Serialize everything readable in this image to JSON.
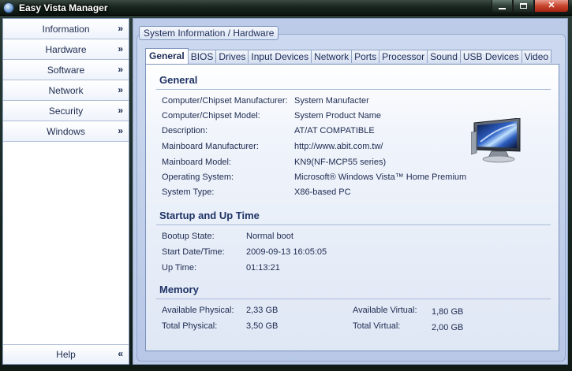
{
  "window": {
    "title": "Easy Vista Manager"
  },
  "sidebar": {
    "items": [
      {
        "label": "Information"
      },
      {
        "label": "Hardware"
      },
      {
        "label": "Software"
      },
      {
        "label": "Network"
      },
      {
        "label": "Security"
      },
      {
        "label": "Windows"
      }
    ],
    "help_label": "Help",
    "expand_glyph": "»",
    "collapse_glyph": "«"
  },
  "content": {
    "group_title": "System  Information / Hardware",
    "tabs": [
      {
        "label": "General",
        "active": true
      },
      {
        "label": "BIOS"
      },
      {
        "label": "Drives"
      },
      {
        "label": "Input Devices"
      },
      {
        "label": "Network"
      },
      {
        "label": "Ports"
      },
      {
        "label": "Processor"
      },
      {
        "label": "Sound"
      },
      {
        "label": "USB Devices"
      },
      {
        "label": "Video"
      }
    ],
    "general": {
      "title": "General",
      "rows": [
        {
          "label": "Computer/Chipset Manufacturer:",
          "value": "System Manufacter"
        },
        {
          "label": "Computer/Chipset Model:",
          "value": "System Product Name"
        },
        {
          "label": "Description:",
          "value": "AT/AT COMPATIBLE"
        },
        {
          "label": "Mainboard Manufacturer:",
          "value": "http://www.abit.com.tw/"
        },
        {
          "label": "Mainboard Model:",
          "value": "KN9(NF-MCP55 series)"
        },
        {
          "label": "Operating System:",
          "value": "Microsoft® Windows Vista™ Home Premium"
        },
        {
          "label": "System Type:",
          "value": "X86-based PC"
        }
      ]
    },
    "startup": {
      "title": "Startup and Up Time",
      "rows": [
        {
          "label": "Bootup State:",
          "value": "Normal boot"
        },
        {
          "label": "Start Date/Time:",
          "value": "2009-09-13 16:05:05"
        },
        {
          "label": "Up Time:",
          "value": "01:13:21"
        }
      ]
    },
    "memory": {
      "title": "Memory",
      "available_physical_label": "Available Physical:",
      "available_physical": "2,33 GB",
      "total_physical_label": "Total Physical:",
      "total_physical": "3,50 GB",
      "available_virtual_label": "Available Virtual:",
      "available_virtual": "1,80 GB",
      "total_virtual_label": "Total Virtual:",
      "total_virtual": "2,00 GB"
    }
  },
  "icons": {
    "app": "globe-icon",
    "computer": "computer-monitor-icon"
  },
  "colors": {
    "accent": "#1f3366",
    "panel_bg": "#bccbe8",
    "close_button": "#c8452d"
  }
}
